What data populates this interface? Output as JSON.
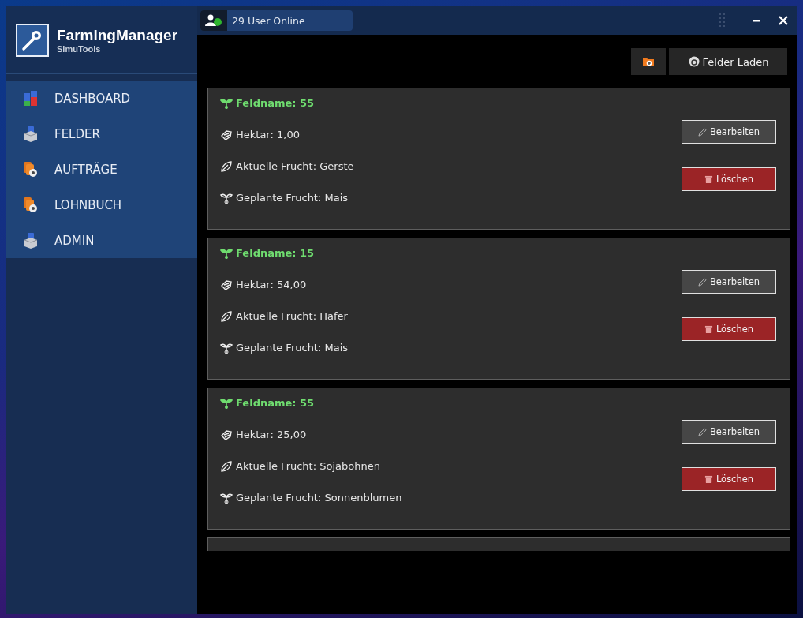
{
  "app": {
    "name": "FarmingManager",
    "subtitle": "SimuTools"
  },
  "nav": [
    {
      "label": "DASHBOARD"
    },
    {
      "label": "FELDER"
    },
    {
      "label": "AUFTRÄGE"
    },
    {
      "label": "LOHNBUCH"
    },
    {
      "label": "ADMIN"
    }
  ],
  "status": {
    "online": "29 User Online"
  },
  "toolbar": {
    "load_button": "Felder Laden"
  },
  "fields": [
    {
      "title": "Feldname: 55",
      "lines": [
        "Hektar: 1,00",
        "Aktuelle Frucht: Gerste",
        "Geplante Frucht: Mais"
      ],
      "buttons": [
        {
          "kind": "edit",
          "label": "Bearbeiten"
        },
        {
          "kind": "delete",
          "label": "Löschen"
        }
      ]
    },
    {
      "title": "Feldname: 15",
      "lines": [
        "Hektar: 54,00",
        "Aktuelle Frucht: Hafer",
        "Geplante Frucht: Mais"
      ],
      "buttons": [
        {
          "kind": "edit",
          "label": "Bearbeiten"
        },
        {
          "kind": "delete",
          "label": "Löschen"
        }
      ]
    },
    {
      "title": "Feldname: 55",
      "lines": [
        "Hektar: 25,00",
        "Aktuelle Frucht: Sojabohnen",
        "Geplante Frucht: Sonnenblumen"
      ],
      "buttons": [
        {
          "kind": "edit",
          "label": "Bearbeiten"
        },
        {
          "kind": "delete",
          "label": "Löschen"
        }
      ]
    },
    {
      "partial": true
    }
  ]
}
